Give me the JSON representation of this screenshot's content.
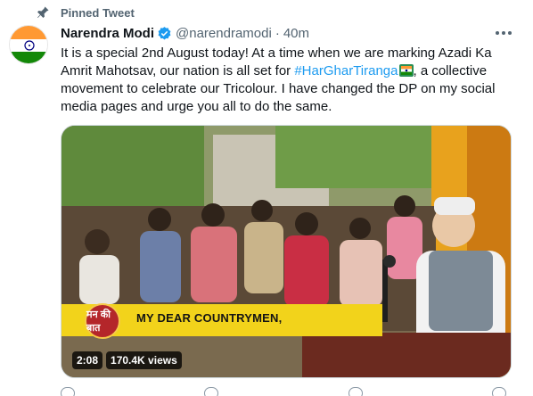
{
  "pinned": {
    "label": "Pinned Tweet"
  },
  "author": {
    "name": "Narendra Modi",
    "handle": "@narendramodi",
    "time": "40m"
  },
  "tweet": {
    "text_part1": "It is a special 2nd August today! At a time when we are marking Azadi Ka Amrit Mahotsav, our nation is all set for ",
    "hashtag": "#HarGharTiranga",
    "text_part2": ", a collective movement to celebrate our Tricolour. I have changed the DP on my social media pages and urge you all to do the same."
  },
  "video": {
    "banner_text": "MY DEAR COUNTRYMEN,",
    "banner_logo_text": "मन की बात",
    "duration": "2:08",
    "views": "170.4K views"
  },
  "colors": {
    "accent": "#1d9bf0",
    "banner": "#f2d31b",
    "saffron": "#ff9933",
    "green": "#138808"
  },
  "icons": [
    "pin-icon",
    "verified-icon",
    "more-icon",
    "flag-emoji-icon"
  ]
}
